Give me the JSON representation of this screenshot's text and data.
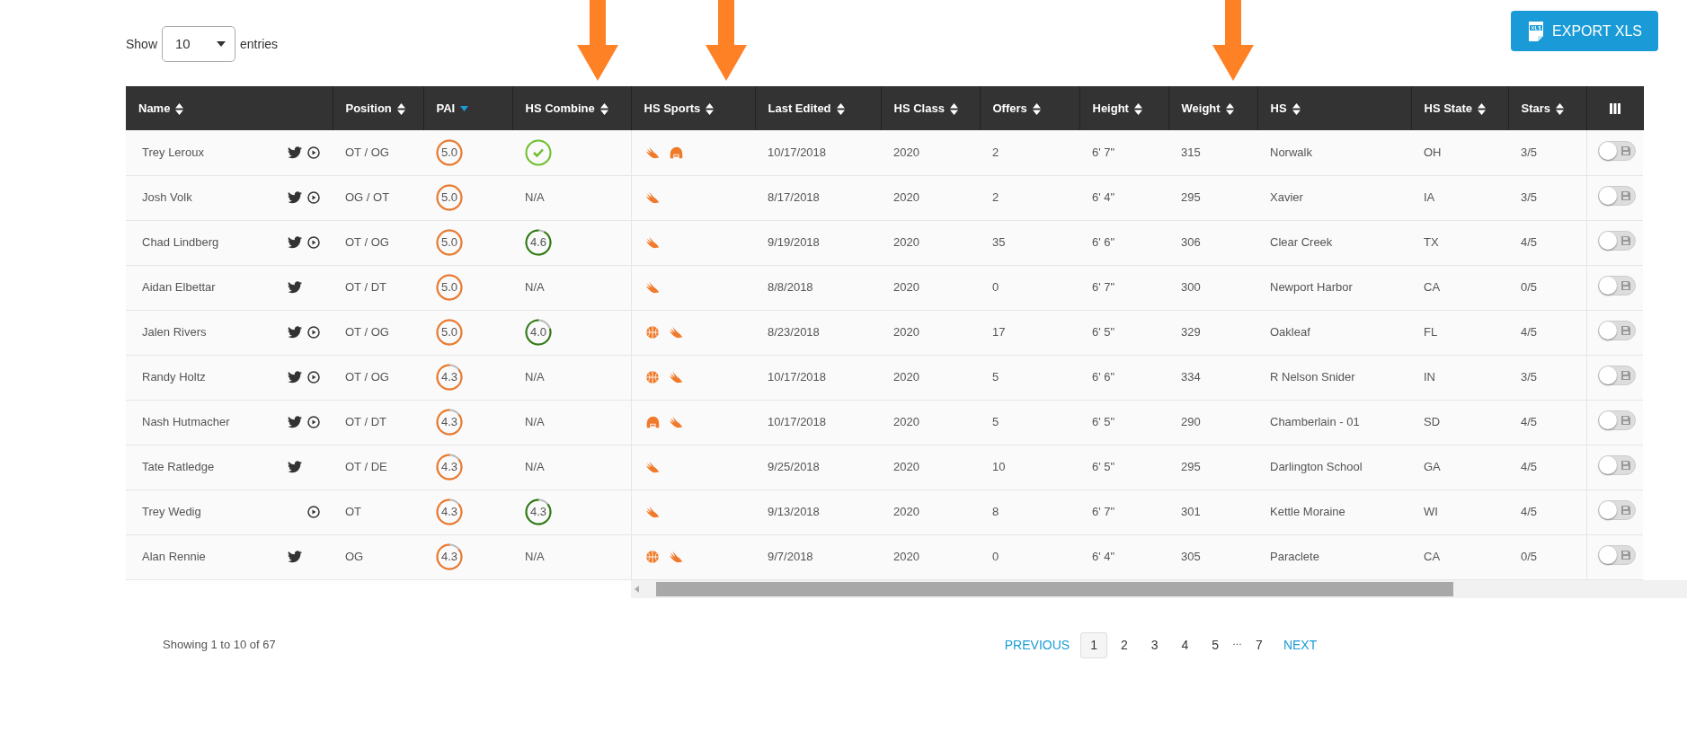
{
  "length_menu": {
    "before": "Show",
    "value": "10",
    "after": "entries"
  },
  "export_button": {
    "label": "EXPORT XLS"
  },
  "table": {
    "columns": [
      {
        "label": "Name",
        "sorted": false
      },
      {
        "label": "Position",
        "sorted": false
      },
      {
        "label": "PAI",
        "sorted": true
      },
      {
        "label": "HS Combine",
        "sorted": false
      },
      {
        "label": "HS Sports",
        "sorted": false
      },
      {
        "label": "Last Edited",
        "sorted": false
      },
      {
        "label": "HS Class",
        "sorted": false
      },
      {
        "label": "Offers",
        "sorted": false
      },
      {
        "label": "Height",
        "sorted": false
      },
      {
        "label": "Weight",
        "sorted": false
      },
      {
        "label": "HS",
        "sorted": false
      },
      {
        "label": "HS State",
        "sorted": false
      },
      {
        "label": "Stars",
        "sorted": false
      }
    ],
    "rows": [
      {
        "name": "Trey Leroux",
        "twitter": true,
        "video": true,
        "position": "OT / OG",
        "pai": "5.0",
        "combine": {
          "kind": "check"
        },
        "sports": [
          {
            "kind": "track"
          },
          {
            "kind": "football"
          }
        ],
        "last_edited": "10/17/2018",
        "hs_class": "2020",
        "offers": "2",
        "height": "6' 7\"",
        "weight": "315",
        "hs": "Norwalk",
        "hs_state": "OH",
        "stars": "3/5",
        "on": false
      },
      {
        "name": "Josh Volk",
        "twitter": true,
        "video": true,
        "position": "OG / OT",
        "pai": "5.0",
        "combine": {
          "kind": "na",
          "text": "N/A"
        },
        "sports": [
          {
            "kind": "track"
          }
        ],
        "last_edited": "8/17/2018",
        "hs_class": "2020",
        "offers": "2",
        "height": "6' 4\"",
        "weight": "295",
        "hs": "Xavier",
        "hs_state": "IA",
        "stars": "3/5",
        "on": false
      },
      {
        "name": "Chad Lindberg",
        "twitter": true,
        "video": true,
        "position": "OT / OG",
        "pai": "5.0",
        "combine": {
          "kind": "score",
          "text": "4.6"
        },
        "sports": [
          {
            "kind": "track"
          }
        ],
        "last_edited": "9/19/2018",
        "hs_class": "2020",
        "offers": "35",
        "height": "6' 6\"",
        "weight": "306",
        "hs": "Clear Creek",
        "hs_state": "TX",
        "stars": "4/5",
        "on": false
      },
      {
        "name": "Aidan Elbettar",
        "twitter": true,
        "video": false,
        "position": "OT / DT",
        "pai": "5.0",
        "combine": {
          "kind": "na",
          "text": "N/A"
        },
        "sports": [
          {
            "kind": "track"
          }
        ],
        "last_edited": "8/8/2018",
        "hs_class": "2020",
        "offers": "0",
        "height": "6' 7\"",
        "weight": "300",
        "hs": "Newport Harbor",
        "hs_state": "CA",
        "stars": "0/5",
        "on": false
      },
      {
        "name": "Jalen Rivers",
        "twitter": true,
        "video": true,
        "position": "OT / OG",
        "pai": "5.0",
        "combine": {
          "kind": "score",
          "text": "4.0"
        },
        "sports": [
          {
            "kind": "basketball"
          },
          {
            "kind": "track"
          }
        ],
        "last_edited": "8/23/2018",
        "hs_class": "2020",
        "offers": "17",
        "height": "6' 5\"",
        "weight": "329",
        "hs": "Oakleaf",
        "hs_state": "FL",
        "stars": "4/5",
        "on": false
      },
      {
        "name": "Randy Holtz",
        "twitter": true,
        "video": true,
        "position": "OT / OG",
        "pai": "4.3",
        "combine": {
          "kind": "na",
          "text": "N/A"
        },
        "sports": [
          {
            "kind": "basketball"
          },
          {
            "kind": "track"
          }
        ],
        "last_edited": "10/17/2018",
        "hs_class": "2020",
        "offers": "5",
        "height": "6' 6\"",
        "weight": "334",
        "hs": "R Nelson Snider",
        "hs_state": "IN",
        "stars": "3/5",
        "on": false
      },
      {
        "name": "Nash Hutmacher",
        "twitter": true,
        "video": true,
        "position": "OT / DT",
        "pai": "4.3",
        "combine": {
          "kind": "na",
          "text": "N/A"
        },
        "sports": [
          {
            "kind": "football"
          },
          {
            "kind": "track"
          }
        ],
        "last_edited": "10/17/2018",
        "hs_class": "2020",
        "offers": "5",
        "height": "6' 5\"",
        "weight": "290",
        "hs": "Chamberlain - 01",
        "hs_state": "SD",
        "stars": "4/5",
        "on": false
      },
      {
        "name": "Tate Ratledge",
        "twitter": true,
        "video": false,
        "position": "OT / DE",
        "pai": "4.3",
        "combine": {
          "kind": "na",
          "text": "N/A"
        },
        "sports": [
          {
            "kind": "track"
          }
        ],
        "last_edited": "9/25/2018",
        "hs_class": "2020",
        "offers": "10",
        "height": "6' 5\"",
        "weight": "295",
        "hs": "Darlington School",
        "hs_state": "GA",
        "stars": "4/5",
        "on": false
      },
      {
        "name": "Trey Wedig",
        "twitter": false,
        "video": true,
        "position": "OT",
        "pai": "4.3",
        "combine": {
          "kind": "score",
          "text": "4.3"
        },
        "sports": [
          {
            "kind": "track"
          }
        ],
        "last_edited": "9/13/2018",
        "hs_class": "2020",
        "offers": "8",
        "height": "6' 7\"",
        "weight": "301",
        "hs": "Kettle Moraine",
        "hs_state": "WI",
        "stars": "4/5",
        "on": false
      },
      {
        "name": "Alan Rennie",
        "twitter": true,
        "video": false,
        "position": "OG",
        "pai": "4.3",
        "combine": {
          "kind": "na",
          "text": "N/A"
        },
        "sports": [
          {
            "kind": "basketball"
          },
          {
            "kind": "track"
          }
        ],
        "last_edited": "9/7/2018",
        "hs_class": "2020",
        "offers": "0",
        "height": "6' 4\"",
        "weight": "305",
        "hs": "Paraclete",
        "hs_state": "CA",
        "stars": "0/5",
        "on": false
      }
    ]
  },
  "info": "Showing 1 to 10 of 67",
  "pagination": {
    "previous": "PREVIOUS",
    "next": "NEXT",
    "pages": [
      {
        "kind": "page",
        "label": "1",
        "selected": true
      },
      {
        "kind": "page",
        "label": "2",
        "selected": false
      },
      {
        "kind": "page",
        "label": "3",
        "selected": false
      },
      {
        "kind": "page",
        "label": "4",
        "selected": false
      },
      {
        "kind": "page",
        "label": "5",
        "selected": false
      },
      {
        "kind": "ellipsis",
        "label": "…"
      },
      {
        "kind": "page",
        "label": "7",
        "selected": false
      }
    ]
  }
}
